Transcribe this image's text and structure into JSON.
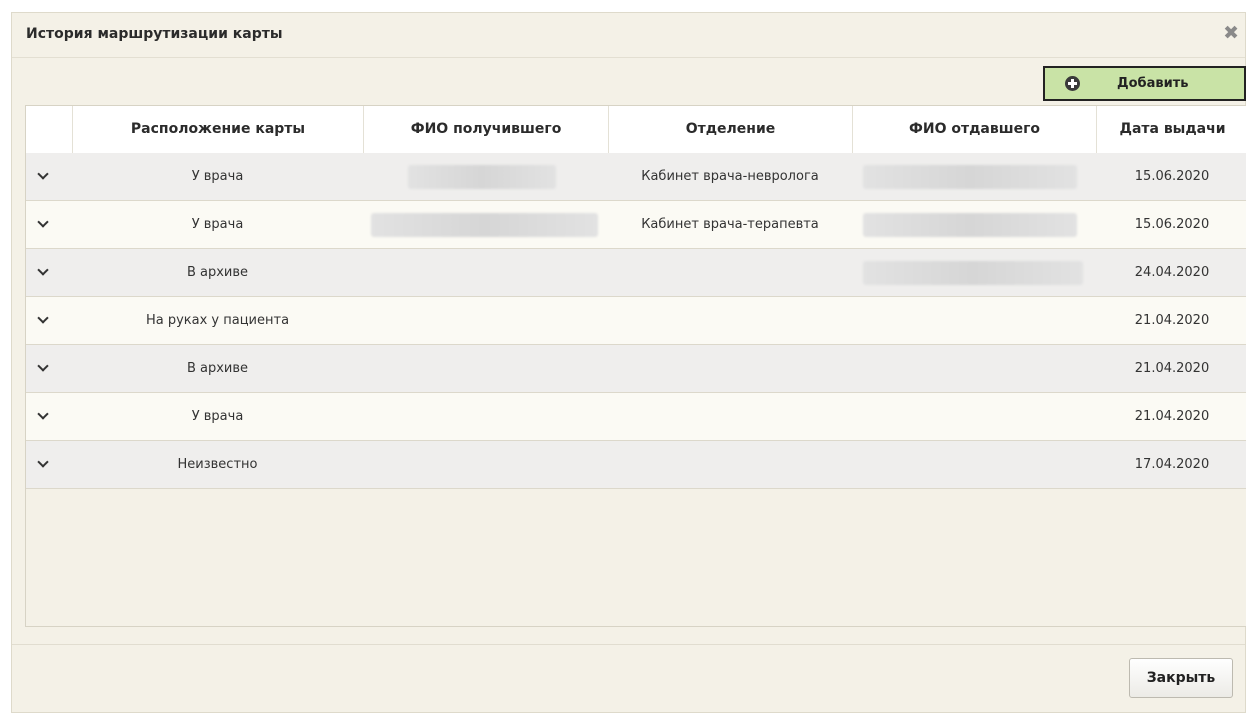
{
  "dialog": {
    "title": "История маршрутизации карты",
    "close_icon": "close-icon",
    "add_label": "Добавить",
    "add_icon": "plus-circle-icon",
    "close_button": "Закрыть",
    "accent": "#c9e3a6"
  },
  "table": {
    "columns": [
      "",
      "Расположение карты",
      "ФИО получившего",
      "Отделение",
      "ФИО отдавшего",
      "Дата выдачи"
    ],
    "rows": [
      {
        "location": "У врача",
        "department": "Кабинет врача-невролога",
        "date": "15.06.2020"
      },
      {
        "location": "У врача",
        "department": "Кабинет врача-терапевта",
        "date": "15.06.2020"
      },
      {
        "location": "В архиве",
        "department": "",
        "date": "24.04.2020"
      },
      {
        "location": "На руках у пациента",
        "department": "",
        "date": "21.04.2020"
      },
      {
        "location": "В архиве",
        "department": "",
        "date": "21.04.2020"
      },
      {
        "location": "У врача",
        "department": "",
        "date": "21.04.2020"
      },
      {
        "location": "Неизвестно",
        "department": "",
        "date": "17.04.2020"
      }
    ]
  }
}
